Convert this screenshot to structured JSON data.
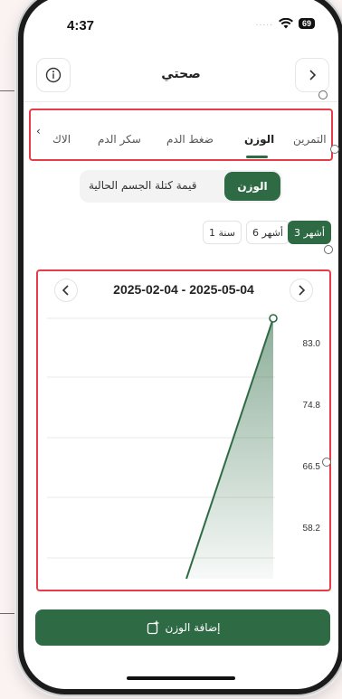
{
  "status": {
    "time": "4:37",
    "battery": "69"
  },
  "header": {
    "title": "صحتي",
    "info_icon": "info-icon",
    "back_icon": "chevron-right-icon"
  },
  "tabs": {
    "items": [
      {
        "label": "التمرين",
        "active": false
      },
      {
        "label": "الوزن",
        "active": true
      },
      {
        "label": "ضغط الدم",
        "active": false
      },
      {
        "label": "سكر الدم",
        "active": false
      },
      {
        "label": "الاك",
        "active": false
      }
    ],
    "more_icon": "chevron-left-icon"
  },
  "metric_toggle": {
    "selected": "الوزن",
    "other": "قيمة كتلة الجسم الحالية"
  },
  "range_pills": [
    {
      "label": "3 أشهر",
      "active": true
    },
    {
      "label": "6 أشهر",
      "active": false
    },
    {
      "label": "1 سنة",
      "active": false
    }
  ],
  "chart": {
    "date_range": "2025-02-04 - 2025-05-04"
  },
  "chart_data": {
    "type": "line",
    "y_ticks": [
      "83.0",
      "74.8",
      "66.5",
      "58.2"
    ],
    "ylim": [
      52,
      83.0
    ],
    "series": [
      {
        "values": [
          52,
          83.0
        ]
      }
    ],
    "grid": true,
    "area_fill": true
  },
  "actions": {
    "add_weight_label": "إضافة الوزن"
  },
  "colors": {
    "accent": "#2e6b45",
    "highlight_border": "#e83b4a"
  }
}
